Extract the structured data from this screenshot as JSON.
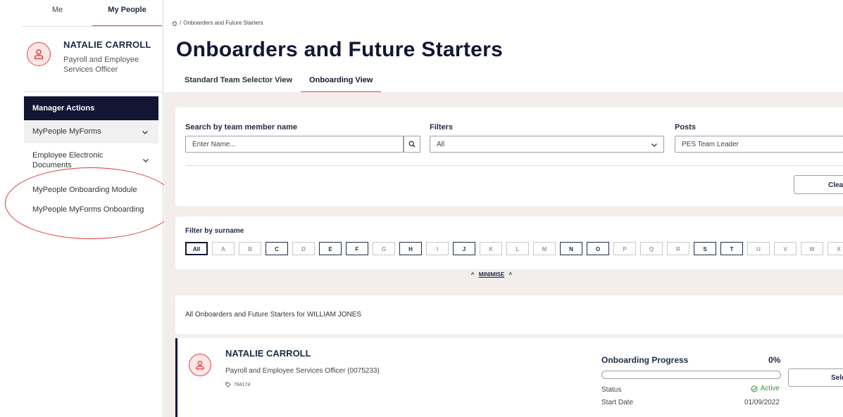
{
  "sidebar": {
    "tabs": [
      {
        "label": "Me",
        "active": false
      },
      {
        "label": "My People",
        "active": true
      }
    ],
    "profile": {
      "name": "NATALIE CARROLL",
      "role": "Payroll and Employee Services Officer"
    },
    "manager_actions_label": "Manager Actions",
    "menu": [
      {
        "label": "MyPeople MyForms",
        "expandable": true
      },
      {
        "label": "Employee Electronic Documents",
        "expandable": true
      },
      {
        "label": "MyPeople Onboarding Module",
        "expandable": false
      },
      {
        "label": "MyPeople MyForms Onboarding",
        "expandable": false
      }
    ]
  },
  "breadcrumb": {
    "separator": "/",
    "current": "Onboarders and Future Starters"
  },
  "page": {
    "title": "Onboarders and Future Starters",
    "view_tabs": [
      {
        "label": "Standard Team Selector View",
        "active": false
      },
      {
        "label": "Onboarding View",
        "active": true
      }
    ]
  },
  "filters": {
    "search_label": "Search by team member name",
    "search_placeholder": "Enter Name...",
    "filters_label": "Filters",
    "filters_value": "All",
    "posts_label": "Posts",
    "posts_value": "PES Team Leader",
    "clear_label": "Clea"
  },
  "surname": {
    "label": "Filter by surname",
    "letters": [
      {
        "l": "All",
        "on": true
      },
      {
        "l": "A",
        "on": false
      },
      {
        "l": "B",
        "on": false
      },
      {
        "l": "C",
        "on": true
      },
      {
        "l": "D",
        "on": false
      },
      {
        "l": "E",
        "on": true
      },
      {
        "l": "F",
        "on": true
      },
      {
        "l": "G",
        "on": false
      },
      {
        "l": "H",
        "on": true
      },
      {
        "l": "I",
        "on": false
      },
      {
        "l": "J",
        "on": true
      },
      {
        "l": "K",
        "on": false
      },
      {
        "l": "L",
        "on": false
      },
      {
        "l": "M",
        "on": false
      },
      {
        "l": "N",
        "on": true
      },
      {
        "l": "O",
        "on": true
      },
      {
        "l": "P",
        "on": false
      },
      {
        "l": "Q",
        "on": false
      },
      {
        "l": "R",
        "on": false
      },
      {
        "l": "S",
        "on": true
      },
      {
        "l": "T",
        "on": true
      },
      {
        "l": "U",
        "on": false
      },
      {
        "l": "V",
        "on": false
      },
      {
        "l": "W",
        "on": false
      },
      {
        "l": "X",
        "on": false
      }
    ]
  },
  "minimise_label": "MINIMISE",
  "info_text": "All Onboarders and Future Starters for WILLIAM JONES",
  "person": {
    "name": "NATALIE CARROLL",
    "role": "Payroll and Employee Services Officer (0075233)",
    "tag": "784174",
    "progress_title": "Onboarding Progress",
    "progress_pct": "0%",
    "progress_value": 0,
    "status_label": "Status",
    "status_value": "Active",
    "start_label": "Start Date",
    "start_value": "01/09/2022",
    "select_label": "Select"
  },
  "colors": {
    "navy": "#121633",
    "accent": "#e0453e",
    "success": "#3a8f3a"
  }
}
